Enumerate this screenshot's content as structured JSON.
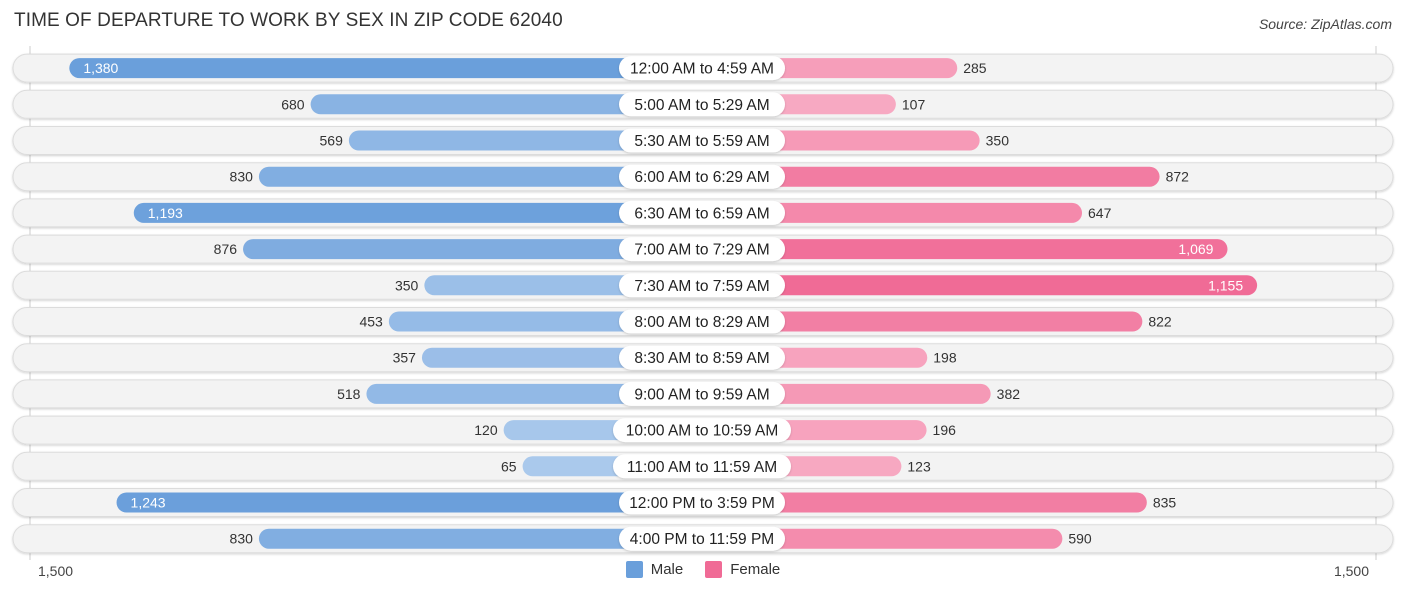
{
  "title": "TIME OF DEPARTURE TO WORK BY SEX IN ZIP CODE 62040",
  "source": "Source: ZipAtlas.com",
  "colors": {
    "male_strong": "#6a9fdb",
    "male_light": "#aecbed",
    "female_strong": "#f06b96",
    "female_light": "#f8afc6",
    "row_bg": "#f2f2f2"
  },
  "chart_data": {
    "type": "bar",
    "orientation": "horizontal-diverging",
    "title": "TIME OF DEPARTURE TO WORK BY SEX IN ZIP CODE 62040",
    "categories": [
      "12:00 AM to 4:59 AM",
      "5:00 AM to 5:29 AM",
      "5:30 AM to 5:59 AM",
      "6:00 AM to 6:29 AM",
      "6:30 AM to 6:59 AM",
      "7:00 AM to 7:29 AM",
      "7:30 AM to 7:59 AM",
      "8:00 AM to 8:29 AM",
      "8:30 AM to 8:59 AM",
      "9:00 AM to 9:59 AM",
      "10:00 AM to 10:59 AM",
      "11:00 AM to 11:59 AM",
      "12:00 PM to 3:59 PM",
      "4:00 PM to 11:59 PM"
    ],
    "series": [
      {
        "name": "Male",
        "side": "left",
        "values": [
          1380,
          680,
          569,
          830,
          1193,
          876,
          350,
          453,
          357,
          518,
          120,
          65,
          1243,
          830
        ],
        "labels": [
          "1,380",
          "680",
          "569",
          "830",
          "1,193",
          "876",
          "350",
          "453",
          "357",
          "518",
          "120",
          "65",
          "1,243",
          "830"
        ]
      },
      {
        "name": "Female",
        "side": "right",
        "values": [
          285,
          107,
          350,
          872,
          647,
          1069,
          1155,
          822,
          198,
          382,
          196,
          123,
          835,
          590
        ],
        "labels": [
          "285",
          "107",
          "350",
          "872",
          "647",
          "1,069",
          "1,155",
          "822",
          "198",
          "382",
          "196",
          "123",
          "835",
          "590"
        ]
      }
    ],
    "xlim": [
      -1500,
      1500
    ],
    "axis_labels": {
      "left": "1,500",
      "right": "1,500"
    },
    "legend": {
      "position": "bottom-center",
      "entries": [
        "Male",
        "Female"
      ]
    },
    "grid": false
  }
}
